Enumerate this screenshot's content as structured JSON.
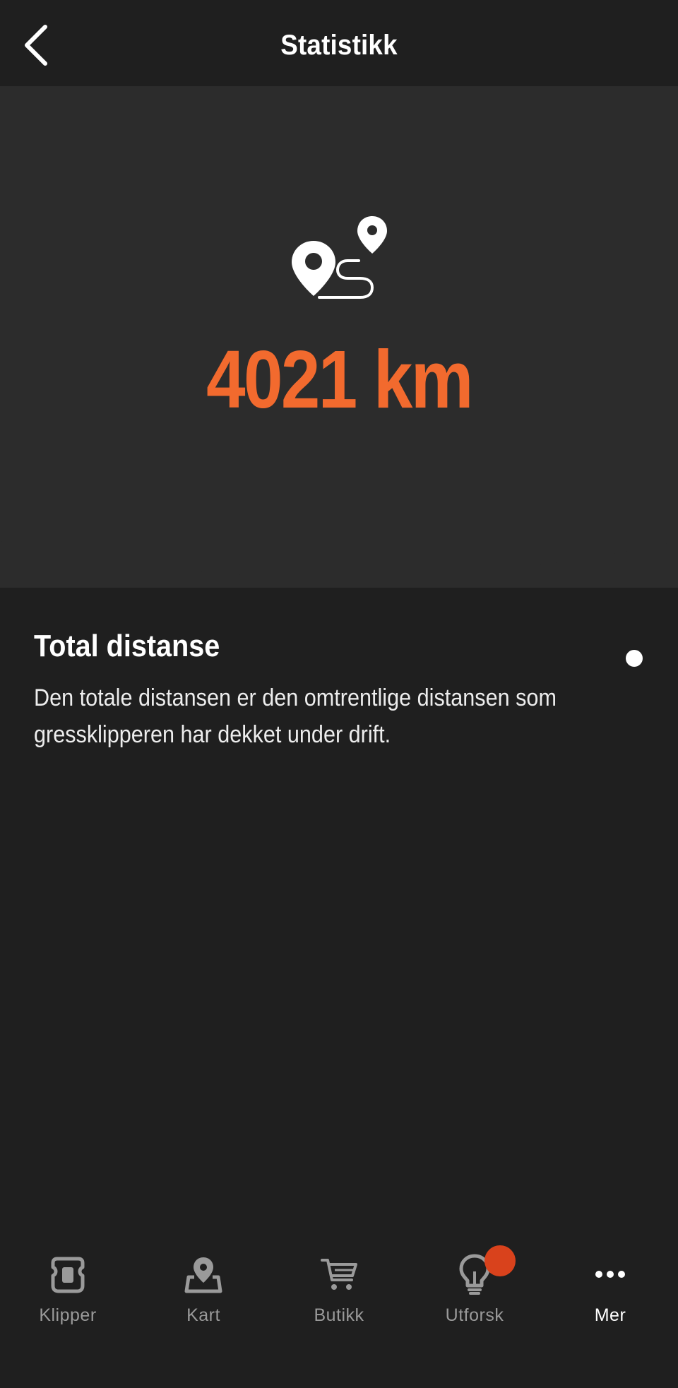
{
  "header": {
    "title": "Statistikk",
    "back_icon": "chevron-left-icon"
  },
  "hero": {
    "icon": "route-icon",
    "distance_value": "4021 km",
    "accent_color": "#f26a2e"
  },
  "info": {
    "title": "Total distanse",
    "description": "Den totale distansen er den omtrentlige distansen som gressklipperen har dekket under drift."
  },
  "nav": {
    "items": [
      {
        "label": "Klipper",
        "icon": "mower-icon",
        "active": false
      },
      {
        "label": "Kart",
        "icon": "map-pin-icon",
        "active": false
      },
      {
        "label": "Butikk",
        "icon": "cart-icon",
        "active": false
      },
      {
        "label": "Utforsk",
        "icon": "lightbulb-icon",
        "active": false,
        "badge": true
      },
      {
        "label": "Mer",
        "icon": "more-icon",
        "active": true
      }
    ],
    "active_color": "#e54b22",
    "badge_color": "#d9421c"
  }
}
